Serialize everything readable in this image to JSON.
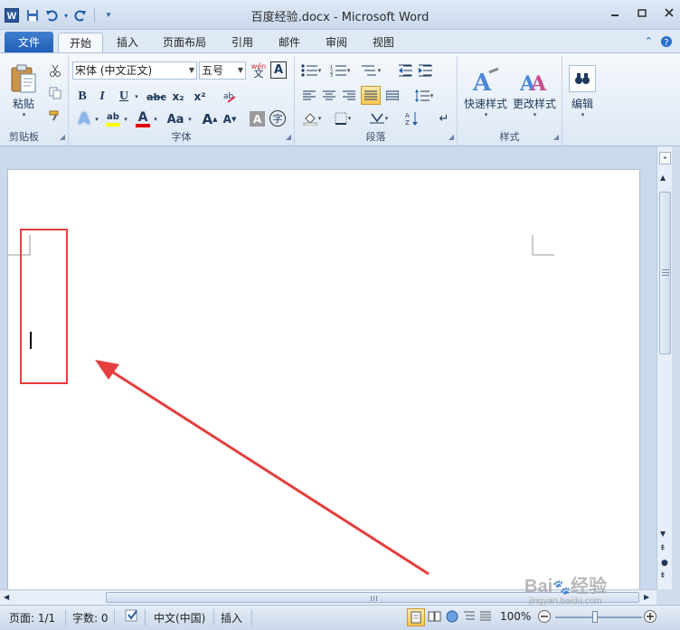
{
  "window": {
    "title": "百度经验.docx - Microsoft Word",
    "logo_letter": "W"
  },
  "tabs": {
    "file": "文件",
    "items": [
      "开始",
      "插入",
      "页面布局",
      "引用",
      "邮件",
      "审阅",
      "视图"
    ],
    "active": "开始"
  },
  "ribbon": {
    "clipboard": {
      "paste": "粘贴",
      "label": "剪贴板"
    },
    "font": {
      "name": "宋体 (中文正文)",
      "size": "五号",
      "label": "字体",
      "bold": "B",
      "italic": "I",
      "underline": "U",
      "strike": "abc",
      "sub": "x₂",
      "sup": "x²",
      "font_color": "A",
      "grow": "A",
      "shrink": "A",
      "change_case": "Aa",
      "char_shading": "A",
      "phonetic": "wén",
      "enclose": "字"
    },
    "paragraph": {
      "label": "段落"
    },
    "styles": {
      "quick": "快速样式",
      "change": "更改样式",
      "label": "样式"
    },
    "editing": {
      "label": "编辑"
    }
  },
  "statusbar": {
    "page": "页面: 1/1",
    "words": "字数: 0",
    "language": "中文(中国)",
    "mode": "插入",
    "zoom": "100%"
  },
  "watermark": {
    "brand": "Bai",
    "brand2": "经验",
    "url": "jingyan.baidu.com"
  },
  "colors": {
    "annotation": "#e53e3e",
    "file_tab": "#2b6cc4",
    "highlight": "#ffff00",
    "font_color": "#e00000"
  }
}
